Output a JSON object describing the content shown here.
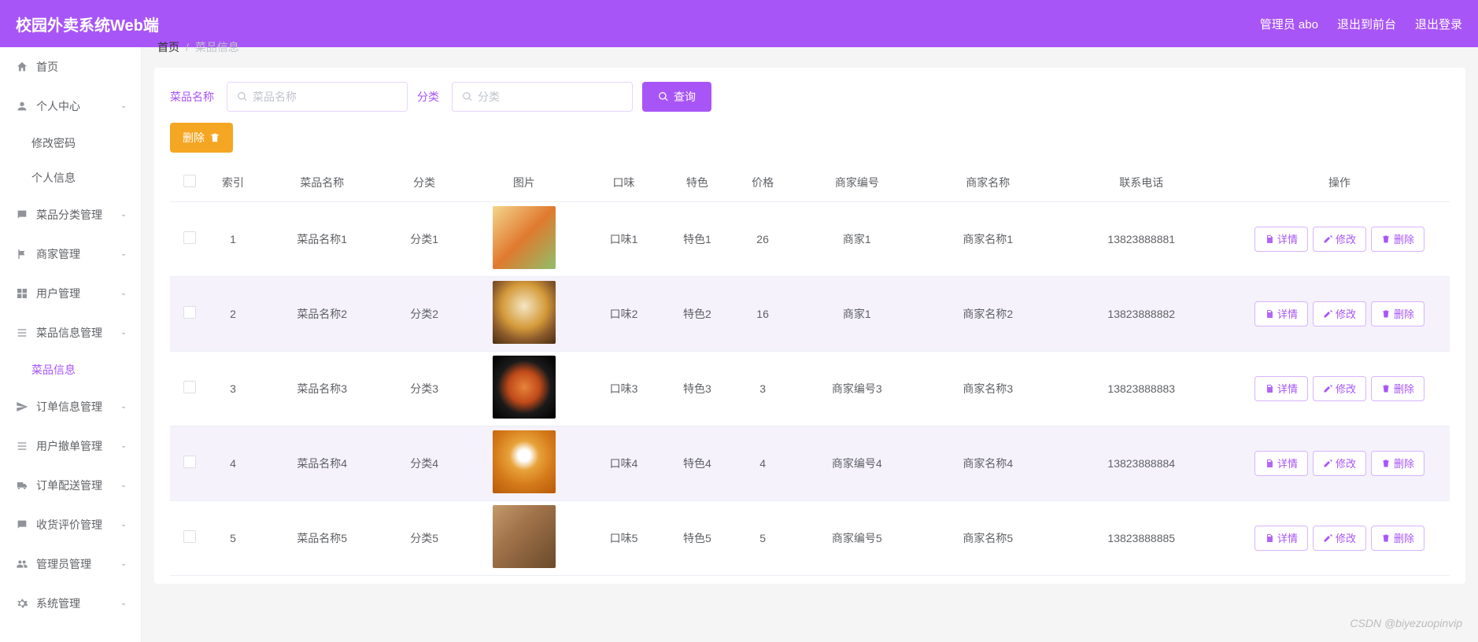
{
  "header": {
    "logo": "校园外卖系统Web端",
    "userLabel": "管理员 abo",
    "frontLabel": "退出到前台",
    "logoutLabel": "退出登录"
  },
  "sidebar": {
    "items": [
      {
        "icon": "home",
        "label": "首页",
        "hasChildren": false
      },
      {
        "icon": "user",
        "label": "个人中心",
        "hasChildren": true,
        "expanded": true,
        "children": [
          {
            "label": "修改密码"
          },
          {
            "label": "个人信息"
          }
        ]
      },
      {
        "icon": "chat",
        "label": "菜品分类管理",
        "hasChildren": true
      },
      {
        "icon": "flag",
        "label": "商家管理",
        "hasChildren": true
      },
      {
        "icon": "grid",
        "label": "用户管理",
        "hasChildren": true
      },
      {
        "icon": "list",
        "label": "菜品信息管理",
        "hasChildren": true,
        "expanded": true,
        "children": [
          {
            "label": "菜品信息",
            "active": true
          }
        ]
      },
      {
        "icon": "send",
        "label": "订单信息管理",
        "hasChildren": true
      },
      {
        "icon": "list",
        "label": "用户撤单管理",
        "hasChildren": true
      },
      {
        "icon": "truck",
        "label": "订单配送管理",
        "hasChildren": true
      },
      {
        "icon": "chat",
        "label": "收货评价管理",
        "hasChildren": true
      },
      {
        "icon": "users",
        "label": "管理员管理",
        "hasChildren": true
      },
      {
        "icon": "gear",
        "label": "系统管理",
        "hasChildren": true
      }
    ]
  },
  "breadcrumb": {
    "root": "首页",
    "current": "菜品信息"
  },
  "search": {
    "label1": "菜品名称",
    "placeholder1": "菜品名称",
    "label2": "分类",
    "placeholder2": "分类",
    "queryBtn": "查询",
    "deleteBtn": "删除"
  },
  "table": {
    "headers": [
      "",
      "索引",
      "菜品名称",
      "分类",
      "图片",
      "口味",
      "特色",
      "价格",
      "商家编号",
      "商家名称",
      "联系电话",
      "操作"
    ],
    "actions": {
      "detail": "详情",
      "edit": "修改",
      "delete": "删除"
    },
    "rows": [
      {
        "idx": "1",
        "name": "菜品名称1",
        "cate": "分类1",
        "imgCls": "thumb1",
        "taste": "口味1",
        "feature": "特色1",
        "price": "26",
        "shopNo": "商家1",
        "shopName": "商家名称1",
        "phone": "13823888881"
      },
      {
        "idx": "2",
        "name": "菜品名称2",
        "cate": "分类2",
        "imgCls": "thumb2",
        "taste": "口味2",
        "feature": "特色2",
        "price": "16",
        "shopNo": "商家1",
        "shopName": "商家名称2",
        "phone": "13823888882"
      },
      {
        "idx": "3",
        "name": "菜品名称3",
        "cate": "分类3",
        "imgCls": "thumb3",
        "taste": "口味3",
        "feature": "特色3",
        "price": "3",
        "shopNo": "商家编号3",
        "shopName": "商家名称3",
        "phone": "13823888883"
      },
      {
        "idx": "4",
        "name": "菜品名称4",
        "cate": "分类4",
        "imgCls": "thumb4",
        "taste": "口味4",
        "feature": "特色4",
        "price": "4",
        "shopNo": "商家编号4",
        "shopName": "商家名称4",
        "phone": "13823888884"
      },
      {
        "idx": "5",
        "name": "菜品名称5",
        "cate": "分类5",
        "imgCls": "thumb5",
        "taste": "口味5",
        "feature": "特色5",
        "price": "5",
        "shopNo": "商家编号5",
        "shopName": "商家名称5",
        "phone": "13823888885"
      }
    ]
  },
  "watermark": "CSDN @biyezuopinvip"
}
